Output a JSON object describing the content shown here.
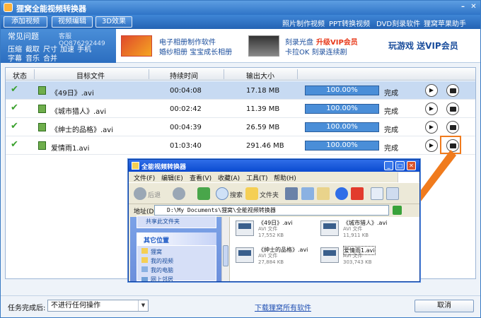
{
  "window": {
    "title": "狸窝全能视频转换器"
  },
  "toolbar": {
    "buttons": [
      "添加视频",
      "视频编辑",
      "3D效果"
    ],
    "links": [
      "照片制作视频",
      "PPT转换视频",
      "DVD刻录软件",
      "狸窝苹果助手"
    ]
  },
  "banner": {
    "faq_title": "常见问题",
    "qq": "客服QQ876292449",
    "faq_links": [
      [
        "压缩",
        "截取",
        "尺寸",
        "加速",
        "手机"
      ],
      [
        "字幕",
        "音乐",
        "合并"
      ]
    ],
    "ad1": [
      "电子相册制作软件",
      "婚纱相册  宝宝成长相册"
    ],
    "ad2_line1": "刻录光盘",
    "ad2_vip": "升级VIP会员",
    "ad2_line2": "卡拉OK  刻录连续剧",
    "ad3": "玩游戏 送VIP会员"
  },
  "table": {
    "headers": [
      "状态",
      "目标文件",
      "持续时间",
      "输出大小"
    ],
    "rows": [
      {
        "file": "《49日》.avi",
        "duration": "00:04:08",
        "size": "17.18 MB",
        "progress": "100.00%",
        "status": "完成"
      },
      {
        "file": "《城市猎人》.avi",
        "duration": "00:02:42",
        "size": "11.39 MB",
        "progress": "100.00%",
        "status": "完成"
      },
      {
        "file": "《绅士的品格》.avi",
        "duration": "00:04:39",
        "size": "26.59 MB",
        "progress": "100.00%",
        "status": "完成"
      },
      {
        "file": "爱情雨1.avi",
        "duration": "01:03:40",
        "size": "291.46 MB",
        "progress": "100.00%",
        "status": "完成"
      }
    ]
  },
  "explorer": {
    "title": "全能视频转换器",
    "menu": [
      "文件(F)",
      "编辑(E)",
      "查看(V)",
      "收藏(A)",
      "工具(T)",
      "帮助(H)"
    ],
    "tools": {
      "back": "后退",
      "search": "搜索",
      "folders": "文件夹"
    },
    "address_label": "地址(D)",
    "address": "D:\\My Documents\\狸窝\\全能视频转换器",
    "share_stub": "共享此文件夹",
    "other_places": "其它位置",
    "places": [
      "狸窝",
      "我的视频",
      "我的电脑",
      "网上邻居"
    ],
    "files": [
      {
        "name": "《49日》.avi",
        "type": "AVI 文件",
        "size": "17,552 KB"
      },
      {
        "name": "《城市猎人》.avi",
        "type": "AVI 文件",
        "size": "11,911 KB"
      },
      {
        "name": "《绅士的品格》.avi",
        "type": "AVI 文件",
        "size": "27,884 KB"
      },
      {
        "name": "爱情雨1.avi",
        "type": "AVI 文件",
        "size": "303,743 KB"
      }
    ]
  },
  "footer": {
    "after_label": "任务完成后:",
    "after_value": "不进行任何操作",
    "download_link": "下载狸窝所有软件",
    "cancel": "取消"
  },
  "colors": {
    "accent": "#2f74c7",
    "highlight": "#f07b1d",
    "check": "#3aa12d"
  }
}
